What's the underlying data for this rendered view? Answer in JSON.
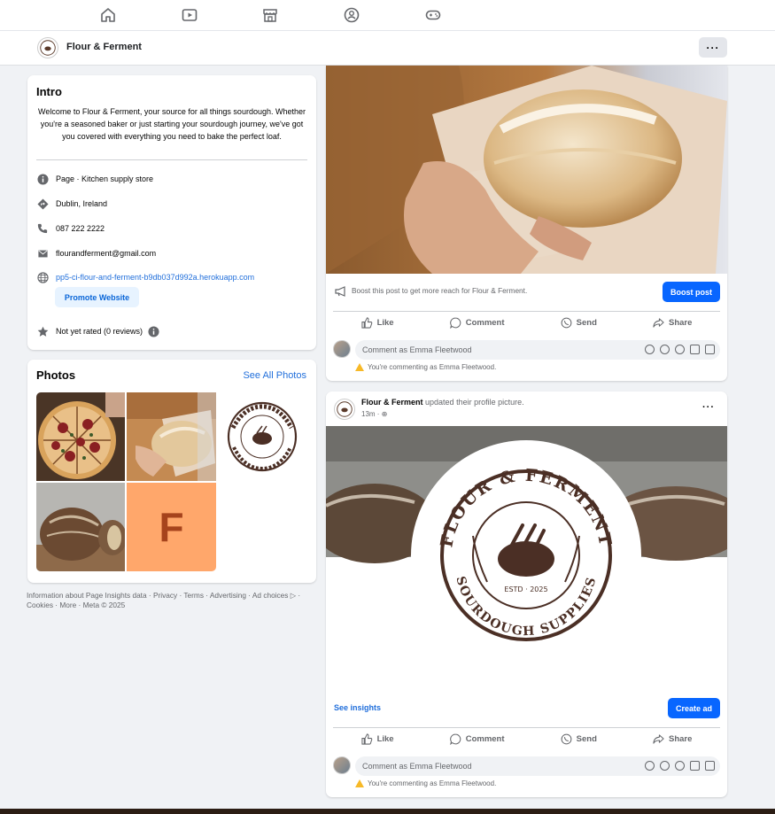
{
  "topnav": {
    "icons": [
      "home-icon",
      "video-icon",
      "marketplace-icon",
      "groups-icon",
      "gaming-icon"
    ]
  },
  "page": {
    "name": "Flour & Ferment",
    "more_label": "···"
  },
  "intro": {
    "title": "Intro",
    "description": "Welcome to Flour & Ferment, your source for all things sourdough. Whether you're a seasoned baker or just starting your sourdough journey, we've got you covered with everything you need to bake the perfect loaf.",
    "category": "Page · Kitchen supply store",
    "location": "Dublin, Ireland",
    "phone": "087 222 2222",
    "email": "flourandferment@gmail.com",
    "website": "pp5-ci-flour-and-ferment-b9db037d992a.herokuapp.com",
    "promote_label": "Promote Website",
    "rating": "Not yet rated (0 reviews)"
  },
  "photos": {
    "title": "Photos",
    "see_all": "See All Photos",
    "tile_letter": "F"
  },
  "footer": {
    "text": "Information about Page Insights data · Privacy · Terms · Advertising · Ad choices ▷ · Cookies · More · Meta © 2025"
  },
  "post1": {
    "boost_text": "Boost this post to get more reach for Flour & Ferment.",
    "boost_button": "Boost post",
    "actions": {
      "like": "Like",
      "comment": "Comment",
      "send": "Send",
      "share": "Share"
    },
    "comment_placeholder": "Comment as Emma Fleetwood",
    "warning": "You're commenting as Emma Fleetwood."
  },
  "post2": {
    "author": "Flour & Ferment",
    "action_text": "updated their profile picture.",
    "time": "13m · ",
    "more": "···",
    "logo": {
      "top_text": "FLOUR & FERMENT",
      "bottom_text": "SOURDOUGH SUPPLIES",
      "estd": "ESTD · 2025"
    },
    "see_insights": "See insights",
    "create_ad": "Create ad",
    "actions": {
      "like": "Like",
      "comment": "Comment",
      "send": "Send",
      "share": "Share"
    },
    "comment_placeholder": "Comment as Emma Fleetwood",
    "warning": "You're commenting as Emma Fleetwood."
  },
  "colors": {
    "accent": "#0866ff",
    "link": "#216fdb",
    "background": "#f0f2f5",
    "tile": "#ffa76b",
    "tile_letter": "#a6431c"
  }
}
